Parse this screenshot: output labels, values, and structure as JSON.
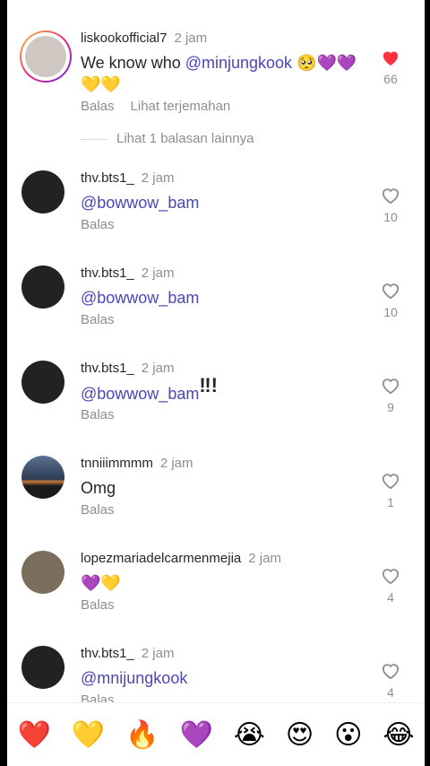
{
  "comments": [
    {
      "user": "liskookofficial7",
      "time": "2 jam",
      "text_plain": "We know who ",
      "mention": "@minjungkook",
      "text_tail": " 🥺💜💜💛💛",
      "reply_label": "Balas",
      "translate_label": "Lihat terjemahan",
      "likes": "66",
      "liked": true
    },
    {
      "user": "thv.bts1_",
      "time": "2 jam",
      "mention": "@bowwow_bam",
      "text_tail": "",
      "reply_label": "Balas",
      "likes": "10"
    },
    {
      "user": "thv.bts1_",
      "time": "2 jam",
      "mention": "@bowwow_bam",
      "text_tail": "",
      "reply_label": "Balas",
      "likes": "10"
    },
    {
      "user": "thv.bts1_",
      "time": "2 jam",
      "mention": "@bowwow_bam",
      "text_tail": "‼!",
      "reply_label": "Balas",
      "likes": "9"
    },
    {
      "user": "tnniiimmmm",
      "time": "2 jam",
      "text_plain": "Omg",
      "reply_label": "Balas",
      "likes": "1"
    },
    {
      "user": "lopezmariadelcarmenmejia",
      "time": "2 jam",
      "text_plain": "💜💛",
      "reply_label": "Balas",
      "likes": "4"
    },
    {
      "user": "thv.bts1_",
      "time": "2 jam",
      "mention": "@mnijungkook",
      "reply_label": "Balas",
      "likes": "4"
    }
  ],
  "more_replies_label": "Lihat 1 balasan lainnya",
  "reactions": [
    "❤️",
    "💛",
    "🔥",
    "💜",
    "😭",
    "😍",
    "😮",
    "😂"
  ],
  "colors": {
    "liked_heart": "#ff3040",
    "mention": "#4a47b8",
    "muted": "#8e8e8e"
  }
}
